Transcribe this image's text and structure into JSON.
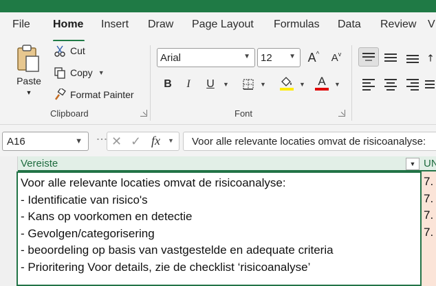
{
  "ribbon_tabs": [
    "File",
    "Home",
    "Insert",
    "Draw",
    "Page Layout",
    "Formulas",
    "Data",
    "Review",
    "V"
  ],
  "active_tab": "Home",
  "clipboard": {
    "paste_label": "Paste",
    "cut_label": "Cut",
    "copy_label": "Copy",
    "format_painter_label": "Format Painter",
    "group_label": "Clipboard"
  },
  "font": {
    "font_name": "Arial",
    "font_size": "12",
    "bold": "B",
    "italic": "I",
    "underline": "U",
    "grow": "A",
    "shrink": "A",
    "font_color_letter": "A",
    "group_label": "Font",
    "highlight_color": "#ffeb00",
    "font_color": "#e00000"
  },
  "formula_bar": {
    "name_box": "A16",
    "fx_label": "fx",
    "formula": "Voor alle relevante locaties omvat de risicoanalyse:"
  },
  "sheet": {
    "column_header": "Vereiste",
    "column_header_2": "UN",
    "active_cell_text": "Voor alle relevante locaties omvat de risicoanalyse:\n- Identificatie van risico's\n- Kans op voorkomen en detectie\n- Gevolgen/categorisering\n- beoordeling op basis van vastgestelde en adequate criteria\n- Prioritering Voor details, zie de checklist ‘risicoanalyse’",
    "right_column_values": [
      "7.",
      "7.",
      "7.",
      "7."
    ]
  },
  "colors": {
    "brand_green": "#1f7a45",
    "header_green_text": "#1e6b3e",
    "adjacent_cell_fill": "#fbe4d8"
  }
}
